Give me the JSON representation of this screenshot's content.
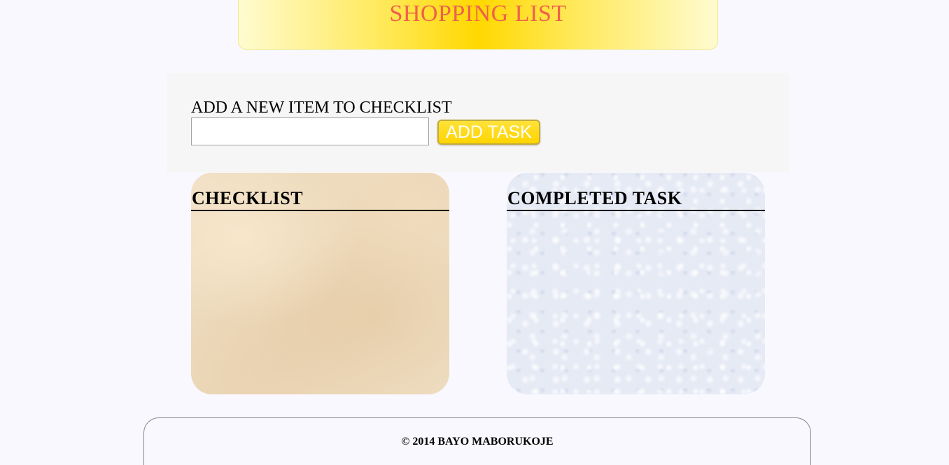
{
  "header": {
    "title": "SHOPPING LIST"
  },
  "form": {
    "label": "ADD A NEW ITEM TO CHECKLIST",
    "input_value": "",
    "input_placeholder": "",
    "add_button_label": "ADD TASK"
  },
  "panels": {
    "checklist_title": "CHECKLIST",
    "completed_title": "COMPLETED TASK"
  },
  "footer": {
    "text": "© 2014 BAYO MABORUKOJE"
  },
  "colors": {
    "title_text": "#f0604c",
    "header_gold": "#ffd800",
    "button_yellow": "#ffd400",
    "page_background": "#f9f8fe"
  }
}
